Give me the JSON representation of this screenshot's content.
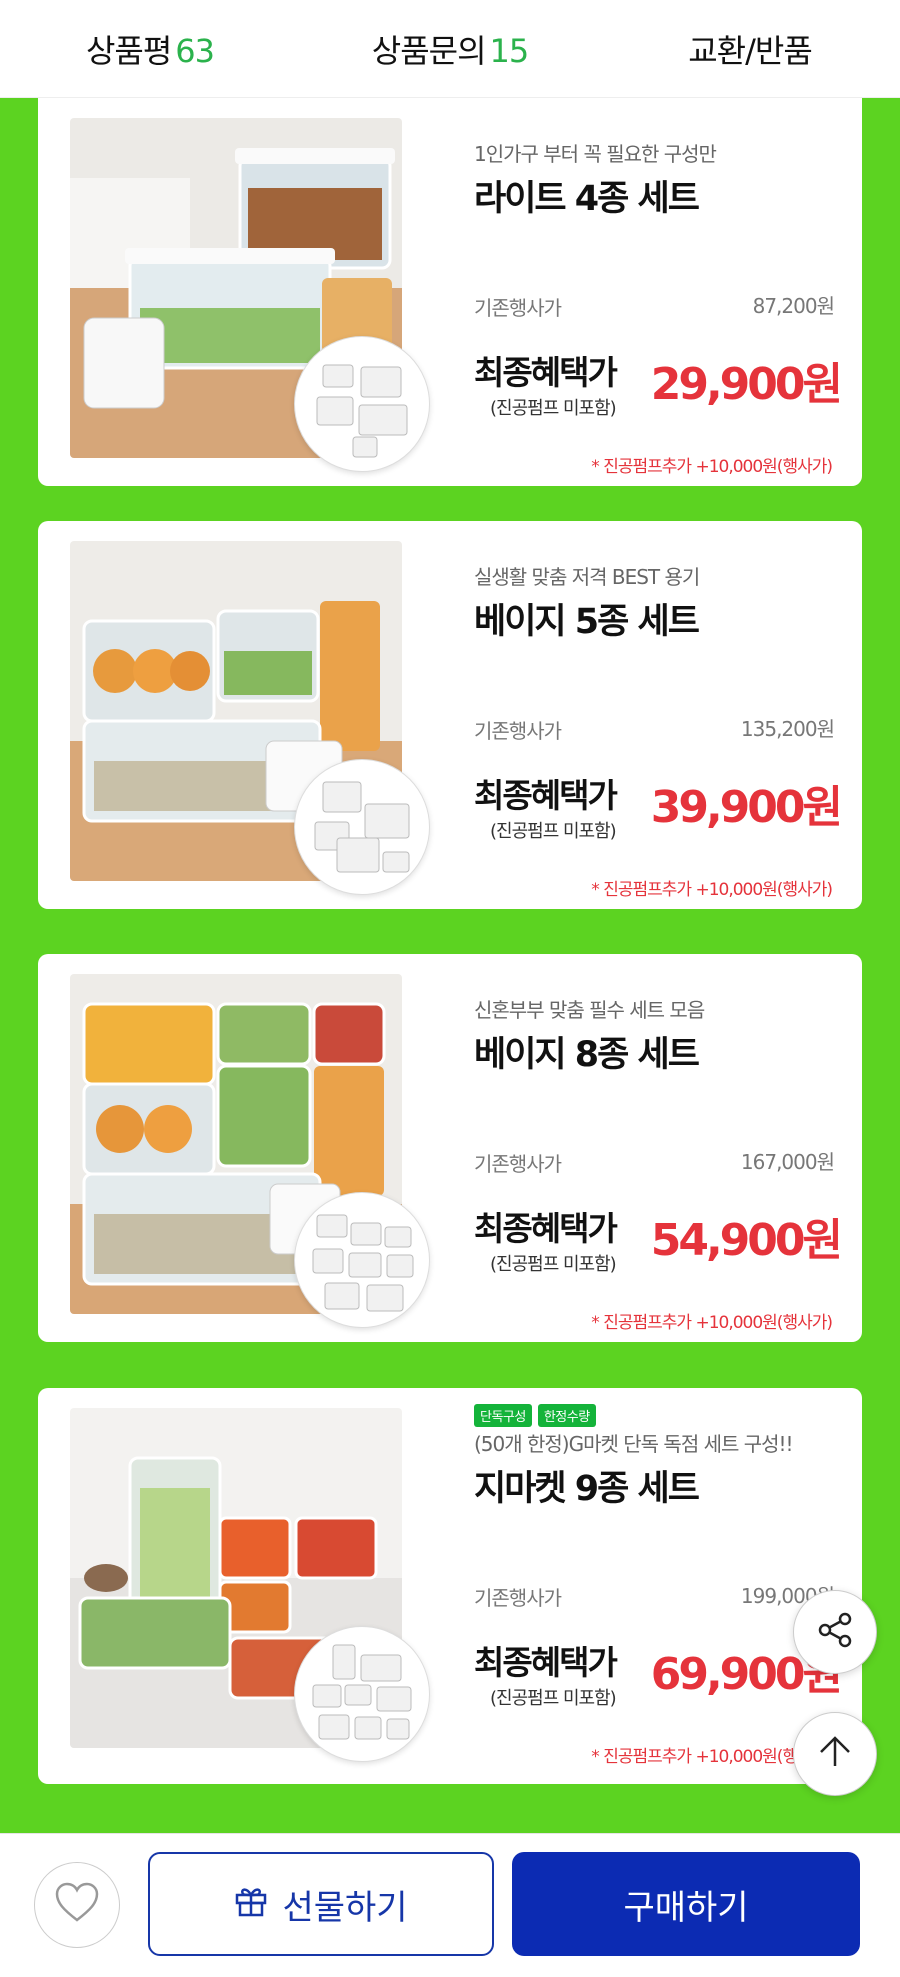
{
  "tabs": [
    {
      "label": "상품평",
      "count": "63"
    },
    {
      "label": "상품문의",
      "count": "15"
    },
    {
      "label": "교환/반품",
      "count": ""
    }
  ],
  "products": [
    {
      "badges": [],
      "subtitle": "1인가구 부터 꼭 필요한 구성만",
      "name": "라이트 4종 세트",
      "orig_label": "기존행사가",
      "orig_price": "87,200원",
      "final_label": "최종혜택가",
      "final_note": "(진공펌프 미포함)",
      "final_price": "29,900원",
      "pump_note": "* 진공펌프추가 +10,000원(행사가)"
    },
    {
      "badges": [],
      "subtitle": "실생활 맞춤 저격 BEST 용기",
      "name": "베이지 5종 세트",
      "orig_label": "기존행사가",
      "orig_price": "135,200원",
      "final_label": "최종혜택가",
      "final_note": "(진공펌프 미포함)",
      "final_price": "39,900원",
      "pump_note": "* 진공펌프추가 +10,000원(행사가)"
    },
    {
      "badges": [],
      "subtitle": "신혼부부 맞춤 필수 세트 모음",
      "name": "베이지 8종 세트",
      "orig_label": "기존행사가",
      "orig_price": "167,000원",
      "final_label": "최종혜택가",
      "final_note": "(진공펌프 미포함)",
      "final_price": "54,900원",
      "pump_note": "* 진공펌프추가 +10,000원(행사가)"
    },
    {
      "badges": [
        "단독구성",
        "한정수량"
      ],
      "subtitle": "(50개 한정)G마켓 단독 독점 세트 구성!!",
      "name": "지마켓 9종 세트",
      "orig_label": "기존행사가",
      "orig_price": "199,000원",
      "final_label": "최종혜택가",
      "final_note": "(진공펌프 미포함)",
      "final_price": "69,900원",
      "pump_note": "* 진공펌프추가 +10,000원(행사가)"
    }
  ],
  "floating": {
    "share_icon": "share-icon",
    "top_icon": "arrow-up-icon"
  },
  "bottom": {
    "like_icon": "heart-icon",
    "gift_label": "선물하기",
    "buy_label": "구매하기"
  },
  "colors": {
    "green": "#5cd321",
    "price_red": "#e5333b",
    "buy_blue": "#0c2bb3",
    "count_green": "#2bb24c"
  }
}
